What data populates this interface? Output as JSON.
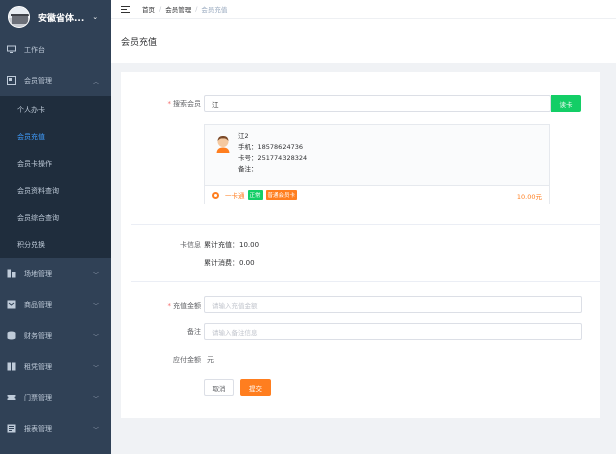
{
  "sidebar": {
    "brand_title": "安徽省体...",
    "items": [
      {
        "label": "工作台",
        "icon": "desktop-icon"
      },
      {
        "label": "会员管理",
        "icon": "member-icon"
      },
      {
        "label": "场地管理",
        "icon": "venue-icon"
      },
      {
        "label": "商品管理",
        "icon": "goods-icon"
      },
      {
        "label": "财务管理",
        "icon": "finance-icon"
      },
      {
        "label": "租凭管理",
        "icon": "rent-icon"
      },
      {
        "label": "门票管理",
        "icon": "ticket-icon"
      },
      {
        "label": "报表管理",
        "icon": "report-icon"
      }
    ],
    "member_sub": [
      {
        "label": "个人办卡",
        "active": false
      },
      {
        "label": "会员充值",
        "active": true
      },
      {
        "label": "会员卡操作",
        "active": false
      },
      {
        "label": "会员资料查询",
        "active": false
      },
      {
        "label": "会员综合查询",
        "active": false
      },
      {
        "label": "积分兑换",
        "active": false
      }
    ]
  },
  "breadcrumb": {
    "home": "首页",
    "section": "会员管理",
    "current": "会员充值",
    "separator": "/"
  },
  "page_title": "会员充值",
  "form": {
    "search_label": "搜索会员",
    "search_value": "江",
    "read_card_button": "读卡",
    "member": {
      "name": "江2",
      "phone": "手机：18578624736",
      "card_no": "卡号：251774328324",
      "remark": "备注："
    },
    "card": {
      "name": "一卡通",
      "status_tag": "正常",
      "type_tag": "普通会员卡",
      "amount": "10.00元"
    },
    "card_info_label": "卡信息",
    "total_recharge": "累计充值：10.00",
    "total_consume": "累计消费：0.00",
    "recharge_label": "充值金额",
    "recharge_placeholder": "请输入充值金额",
    "remark_label": "备注",
    "remark_placeholder": "请输入备注信息",
    "payable_label": "应付金额",
    "payable_value": "元",
    "cancel_button": "取消",
    "submit_button": "提交"
  },
  "colors": {
    "sidebar_bg": "#304156",
    "submenu_bg": "#1f2d3d",
    "active_link": "#409eff",
    "accent_orange": "#ff7e1f",
    "accent_green": "#13ce66"
  }
}
